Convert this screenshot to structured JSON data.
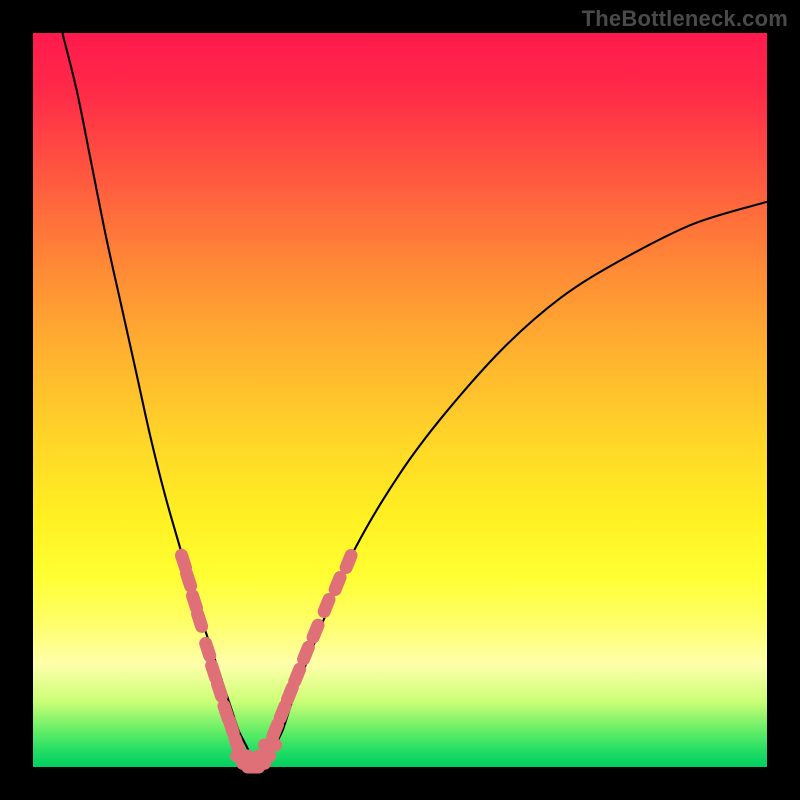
{
  "watermark": "TheBottleneck.com",
  "colors": {
    "background": "#000000",
    "curve": "#000000",
    "marker": "#e07078",
    "gradient_stops": [
      [
        "0%",
        "#ff1a4d"
      ],
      [
        "8%",
        "#ff2a48"
      ],
      [
        "20%",
        "#ff5a3f"
      ],
      [
        "32%",
        "#ff8a36"
      ],
      [
        "44%",
        "#ffb32f"
      ],
      [
        "56%",
        "#ffd728"
      ],
      [
        "66%",
        "#fff022"
      ],
      [
        "74%",
        "#ffff33"
      ],
      [
        "80%",
        "#ffff66"
      ],
      [
        "86%",
        "#ffffaa"
      ],
      [
        "91%",
        "#ccff77"
      ],
      [
        "95%",
        "#66ee66"
      ],
      [
        "98%",
        "#1edc64"
      ],
      [
        "100%",
        "#00d060"
      ]
    ]
  },
  "chart_data": {
    "type": "line",
    "title": "",
    "xlabel": "",
    "ylabel": "",
    "x_range": [
      0,
      100
    ],
    "y_range": [
      0,
      100
    ],
    "note": "Values are read in plot-area percent coordinates. y is inverted visually (0 = top of gradient area, 100 = bottom). The chart shows a bottleneck V-curve reaching its minimum near x≈30.",
    "series": [
      {
        "name": "bottleneck-curve",
        "x": [
          4,
          6,
          8,
          10,
          12,
          14,
          16,
          18,
          20,
          22,
          24,
          26,
          27,
          28,
          29,
          30,
          31,
          32,
          33,
          34,
          35,
          36,
          38,
          40,
          44,
          50,
          56,
          64,
          72,
          80,
          90,
          100
        ],
        "y": [
          0,
          8,
          18,
          28,
          37,
          46,
          55,
          63,
          70,
          77,
          83,
          89,
          92,
          95,
          97,
          99,
          100,
          99,
          97,
          95,
          92,
          89,
          84,
          79,
          70,
          60,
          52,
          43,
          36,
          31,
          26,
          23
        ]
      },
      {
        "name": "markers-left-branch",
        "x": [
          20.5,
          21.2,
          22.0,
          22.7,
          23.8,
          24.6,
          25.4,
          26.3,
          27.0,
          27.8
        ],
        "y": [
          72.0,
          74.5,
          77.5,
          80.0,
          84.0,
          87.0,
          89.5,
          92.5,
          94.5,
          97.0
        ]
      },
      {
        "name": "markers-bottom",
        "x": [
          28.5,
          29.3,
          30.0,
          30.8,
          31.5,
          32.3
        ],
        "y": [
          98.5,
          99.5,
          100.0,
          99.5,
          98.5,
          97.0
        ]
      },
      {
        "name": "markers-right-branch",
        "x": [
          33.0,
          34.0,
          35.0,
          36.0,
          37.2,
          38.5,
          40.0,
          41.5,
          43.0
        ],
        "y": [
          95.0,
          92.5,
          90.0,
          87.5,
          84.5,
          81.5,
          78.0,
          75.0,
          72.0
        ]
      }
    ]
  }
}
